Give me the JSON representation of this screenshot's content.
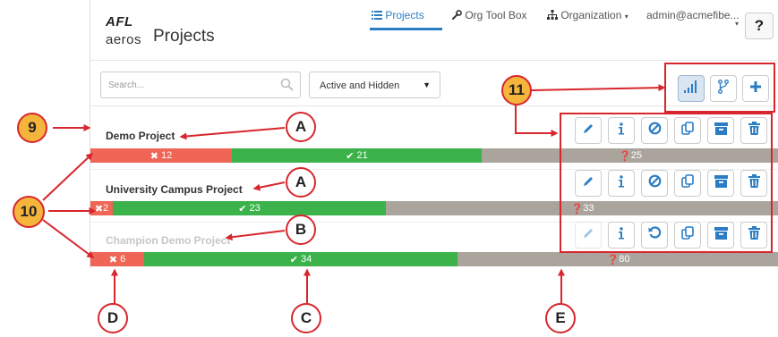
{
  "header": {
    "logo_top": "AFL",
    "logo_bottom": "aeros",
    "title": "Projects",
    "nav": {
      "projects": "Projects",
      "org_tool_box": "Org Tool Box",
      "organization": "Organization",
      "user": "admin@acmefibe..."
    },
    "help_label": "?"
  },
  "toolbar": {
    "search_placeholder": "Search...",
    "filter_value": "Active and Hidden",
    "buttons": [
      "stats-icon",
      "branch-icon",
      "plus-icon"
    ]
  },
  "projects": [
    {
      "name": "Demo Project",
      "hidden": false,
      "fail": "12",
      "pass": "21",
      "untested": "25"
    },
    {
      "name": "University Campus Project",
      "hidden": false,
      "fail": "2",
      "pass": "23",
      "untested": "33"
    },
    {
      "name": "Champion Demo Project",
      "hidden": true,
      "fail": "6",
      "pass": "34",
      "untested": "80"
    }
  ],
  "row_actions": [
    "pencil-icon",
    "info-icon",
    "block-icon",
    "copy-icon",
    "archive-icon",
    "trash-icon"
  ],
  "row_actions_hidden": [
    "pencil-icon",
    "info-icon",
    "restore-icon",
    "copy-icon",
    "archive-icon",
    "trash-icon"
  ],
  "callouts": {
    "a1": "A",
    "a2": "A",
    "b": "B",
    "c": "C",
    "d": "D",
    "e": "E",
    "n9": "9",
    "n10": "10",
    "n11": "11"
  },
  "colors": {
    "fail": "#ef6657",
    "pass": "#3bb34a",
    "untested": "#aaa49d",
    "accent": "#2a7dc4",
    "callout_red": "#d8262c",
    "callout_yellow": "#f5b43c"
  }
}
